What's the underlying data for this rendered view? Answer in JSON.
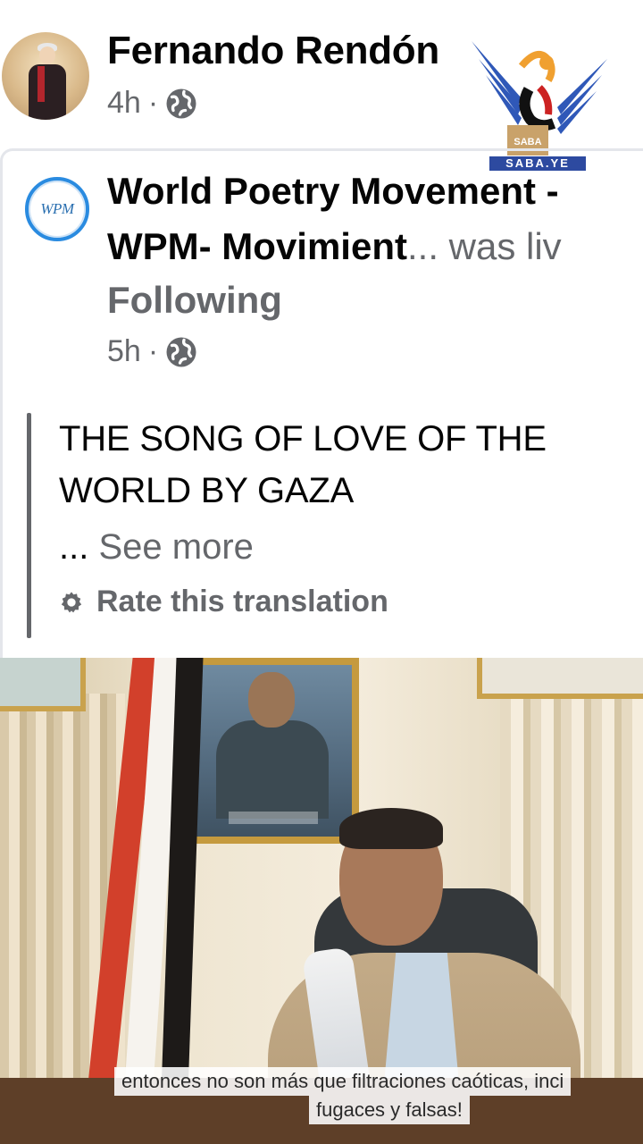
{
  "post": {
    "author": "Fernando Rendón",
    "time": "4h",
    "separator": "·"
  },
  "watermark": {
    "tag": "SABA.YE",
    "emblem_text": "SABA"
  },
  "shared": {
    "page_logo_text": "WPM",
    "page_name_line1": "World Poetry Movement -",
    "page_name_line2_bold": "WPM- Movimient",
    "page_name_line2_rest": "... was liv",
    "following": "Following",
    "time": "5h",
    "separator": "·",
    "text": "THE SONG OF LOVE OF THE WORLD BY GAZA",
    "ellipsis": "...",
    "see_more": "See more",
    "rate_translation": "Rate this translation"
  },
  "video": {
    "subtitle_line1": "entonces no son más que filtraciones caóticas, inci",
    "subtitle_line2": "fugaces y falsas!"
  },
  "colors": {
    "text_primary": "#050505",
    "text_secondary": "#65676b",
    "divider": "#e4e6eb",
    "wpm_blue": "#2a8be0",
    "saba_blue": "#2d4aa0"
  },
  "icons": {
    "globe": "globe-icon",
    "gear": "gear-icon"
  }
}
